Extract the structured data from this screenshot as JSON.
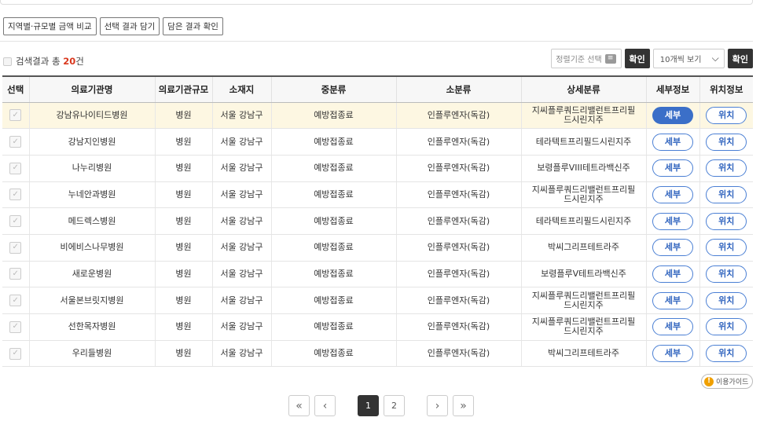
{
  "toolbar": {
    "compare_label": "지역별·규모별 금액 비교",
    "add_selected_label": "선택 결과 담기",
    "view_selected_label": "담은 결과 확인"
  },
  "results": {
    "prefix": "검색결과 총 ",
    "count": "20",
    "suffix": "건"
  },
  "controls": {
    "sort_label": "정렬기준 선택",
    "confirm_label": "확인",
    "page_size_label": "10개씩 보기",
    "page_size_confirm_label": "확인"
  },
  "table": {
    "headers": [
      "선택",
      "의료기관명",
      "의료기관규모",
      "소재지",
      "중분류",
      "소분류",
      "상세분류",
      "세부정보",
      "위치정보"
    ],
    "detail_label": "세부",
    "location_label": "위치",
    "rows": [
      {
        "name": "강남유나이티드병원",
        "size": "병원",
        "location": "서울 강남구",
        "mid": "예방접종료",
        "sub": "인플루엔자(독감)",
        "detail": [
          "지씨플루쿼드리밸런트프리필",
          "드시린지주"
        ],
        "highlight": true
      },
      {
        "name": "강남지인병원",
        "size": "병원",
        "location": "서울 강남구",
        "mid": "예방접종료",
        "sub": "인플루엔자(독감)",
        "detail": [
          "테라텍트프리필드시린지주"
        ],
        "highlight": false
      },
      {
        "name": "나누리병원",
        "size": "병원",
        "location": "서울 강남구",
        "mid": "예방접종료",
        "sub": "인플루엔자(독감)",
        "detail": [
          "보령플루VIII테트라백신주"
        ],
        "highlight": false
      },
      {
        "name": "누네안과병원",
        "size": "병원",
        "location": "서울 강남구",
        "mid": "예방접종료",
        "sub": "인플루엔자(독감)",
        "detail": [
          "지씨플루쿼드리밸런트프리필",
          "드시린지주"
        ],
        "highlight": false
      },
      {
        "name": "메드렉스병원",
        "size": "병원",
        "location": "서울 강남구",
        "mid": "예방접종료",
        "sub": "인플루엔자(독감)",
        "detail": [
          "테라텍트프리필드시린지주"
        ],
        "highlight": false
      },
      {
        "name": "비에비스나무병원",
        "size": "병원",
        "location": "서울 강남구",
        "mid": "예방접종료",
        "sub": "인플루엔자(독감)",
        "detail": [
          "박씨그리프테트라주"
        ],
        "highlight": false
      },
      {
        "name": "새로운병원",
        "size": "병원",
        "location": "서울 강남구",
        "mid": "예방접종료",
        "sub": "인플루엔자(독감)",
        "detail": [
          "보령플루Ⅴ테트라백신주"
        ],
        "highlight": false
      },
      {
        "name": "서울본브릿지병원",
        "size": "병원",
        "location": "서울 강남구",
        "mid": "예방접종료",
        "sub": "인플루엔자(독감)",
        "detail": [
          "지씨플루쿼드리밸런트프리필",
          "드시린지주"
        ],
        "highlight": false
      },
      {
        "name": "선한목자병원",
        "size": "병원",
        "location": "서울 강남구",
        "mid": "예방접종료",
        "sub": "인플루엔자(독감)",
        "detail": [
          "지씨플루쿼드리밸런트프리필",
          "드시린지주"
        ],
        "highlight": false
      },
      {
        "name": "우리들병원",
        "size": "병원",
        "location": "서울 강남구",
        "mid": "예방접종료",
        "sub": "인플루엔자(독감)",
        "detail": [
          "박씨그리프테트라주"
        ],
        "highlight": false
      }
    ]
  },
  "guide": {
    "label": "이용가이드",
    "icon": "info-icon"
  },
  "pagination": {
    "pages": [
      "1",
      "2"
    ],
    "current": "1",
    "icons": [
      "first-page-icon",
      "prev-page-icon",
      "next-page-icon",
      "last-page-icon"
    ]
  },
  "colors": {
    "accent_blue": "#3b6fc8",
    "count_red": "#d9381e",
    "highlight_row": "#fdf7e2",
    "dark_button": "#333333"
  }
}
